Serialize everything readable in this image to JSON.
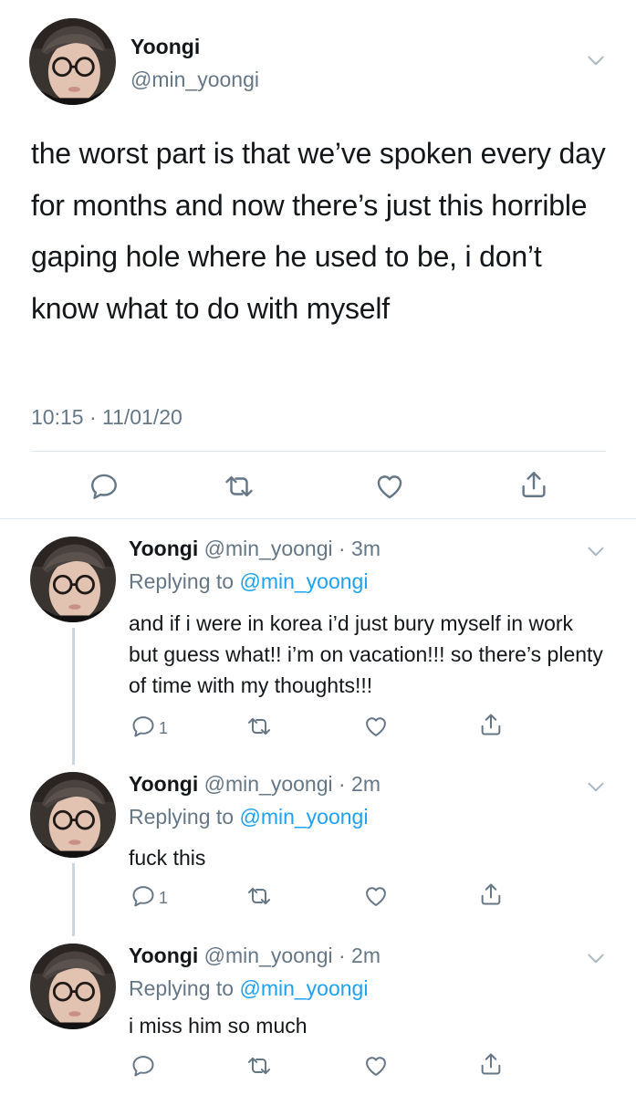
{
  "main_tweet": {
    "name": "Yoongi",
    "handle": "@min_yoongi",
    "text": "the worst part is that we’ve spoken every day for months and now there’s just this horrible gaping hole where he used to be, i don’t know what to do with myself",
    "timestamp": "10:15 · 11/01/20"
  },
  "replies": [
    {
      "name": "Yoongi",
      "handle_time": "@min_yoongi · 3m",
      "replying_prefix": "Replying to ",
      "replying_to": "@min_yoongi",
      "text": "and if i were in korea i’d just bury myself in work but guess what!! i’m on vacation!!! so there’s plenty of time with my thoughts!!!",
      "reply_count": "1"
    },
    {
      "name": "Yoongi",
      "handle_time": "@min_yoongi · 2m",
      "replying_prefix": "Replying to ",
      "replying_to": "@min_yoongi",
      "text": "fuck this",
      "reply_count": "1"
    },
    {
      "name": "Yoongi",
      "handle_time": "@min_yoongi · 2m",
      "replying_prefix": "Replying to ",
      "replying_to": "@min_yoongi",
      "text": "i miss him so much",
      "reply_count": ""
    }
  ],
  "colors": {
    "text": "#14171a",
    "secondary": "#657786",
    "link": "#1da1f2",
    "divider": "#e1e8ed"
  },
  "icons": [
    "avatar",
    "chevron-down-icon",
    "reply-icon",
    "retweet-icon",
    "like-icon",
    "share-icon"
  ]
}
